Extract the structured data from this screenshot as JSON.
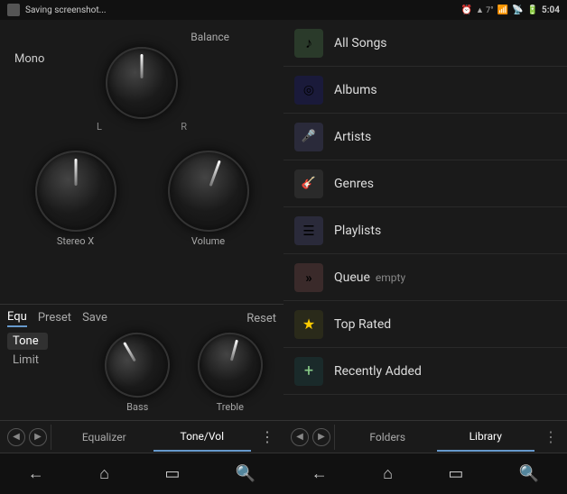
{
  "left": {
    "statusbar": {
      "text": "Saving screenshot..."
    },
    "balance_label": "Balance",
    "mono_label": "Mono",
    "l_label": "L",
    "r_label": "R",
    "stereo_label": "Stereo X",
    "volume_label": "Volume",
    "tabs": {
      "equ": "Equ",
      "preset": "Preset",
      "save": "Save",
      "reset": "Reset"
    },
    "side_tabs": [
      "Tone",
      "Limit"
    ],
    "eq_knobs": {
      "bass": "Bass",
      "treble": "Treble"
    },
    "bottom_tabs": {
      "equalizer": "Equalizer",
      "tone_vol": "Tone/Vol"
    },
    "nav": {
      "back": "←",
      "home": "⌂",
      "recents": "▭",
      "search": "🔍"
    }
  },
  "right": {
    "statusbar": {
      "alarm": "⏰",
      "wifi": "▼",
      "signal": "▐",
      "battery": "▮",
      "time": "5:04"
    },
    "menu_items": [
      {
        "id": "all-songs",
        "icon": "♪",
        "icon_bg": "#2a3a2a",
        "label": "All Songs",
        "badge": ""
      },
      {
        "id": "albums",
        "icon": "◎",
        "icon_bg": "#1a1a3a",
        "label": "Albums",
        "badge": ""
      },
      {
        "id": "artists",
        "icon": "🎤",
        "icon_bg": "#2a2a3a",
        "label": "Artists",
        "badge": ""
      },
      {
        "id": "genres",
        "icon": "🎸",
        "icon_bg": "#2a2a2a",
        "label": "Genres",
        "badge": ""
      },
      {
        "id": "playlists",
        "icon": "☰",
        "icon_bg": "#2a2a3a",
        "label": "Playlists",
        "badge": ""
      },
      {
        "id": "queue",
        "icon": "»",
        "icon_bg": "#3a2a2a",
        "label": "Queue",
        "badge": "empty"
      },
      {
        "id": "top-rated",
        "icon": "★",
        "icon_bg": "#2a2a1a",
        "label": "Top Rated",
        "badge": ""
      },
      {
        "id": "recently-added",
        "icon": "+",
        "icon_bg": "#1a2a2a",
        "label": "Recently Added",
        "badge": ""
      }
    ],
    "bottom_tabs": {
      "folders": "Folders",
      "library": "Library"
    },
    "nav": {
      "back": "←",
      "home": "⌂",
      "recents": "▭",
      "search": "🔍"
    }
  }
}
